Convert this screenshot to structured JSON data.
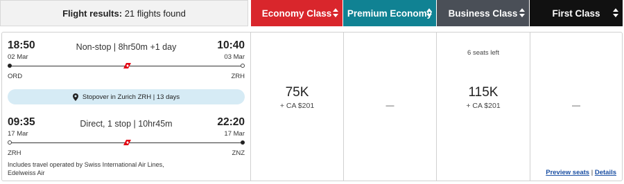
{
  "header": {
    "results_label": "Flight results:",
    "results_count": "21 flights found"
  },
  "cabins": [
    {
      "label": "Economy Class",
      "color": "#d9262c"
    },
    {
      "label": "Premium Economy",
      "color": "#108293"
    },
    {
      "label": "Business Class",
      "color": "#4a4f57"
    },
    {
      "label": "First Class",
      "color": "#111111"
    }
  ],
  "outbound": {
    "dep_time": "18:50",
    "dep_date": "02 Mar",
    "summary": "Non-stop | 8hr50m +1 day",
    "arr_time": "10:40",
    "arr_date": "03 Mar",
    "origin": "ORD",
    "destination": "ZRH"
  },
  "stopover": {
    "text": "Stopover in Zurich ZRH | 13 days"
  },
  "inbound": {
    "dep_time": "09:35",
    "dep_date": "17 Mar",
    "summary": "Direct, 1 stop | 10hr45m",
    "arr_time": "22:20",
    "arr_date": "17 Mar",
    "origin": "ZRH",
    "destination": "ZNZ"
  },
  "operated_by": "Includes travel operated by Swiss International Air Lines, Edelweiss Air",
  "links": {
    "preview_seats": "Preview seats",
    "separator": "|",
    "details": "Details"
  },
  "fares": {
    "economy": {
      "points": "75K",
      "tax": "+ CA $201"
    },
    "premium": {
      "empty": "—"
    },
    "business": {
      "seats_left": "6 seats left",
      "points": "115K",
      "tax": "+ CA $201"
    },
    "first": {
      "empty": "—"
    }
  },
  "icons": {
    "map_pin": "map-pin-icon",
    "airline_logo": "swiss-tail-icon",
    "sort": "sort-icon"
  }
}
